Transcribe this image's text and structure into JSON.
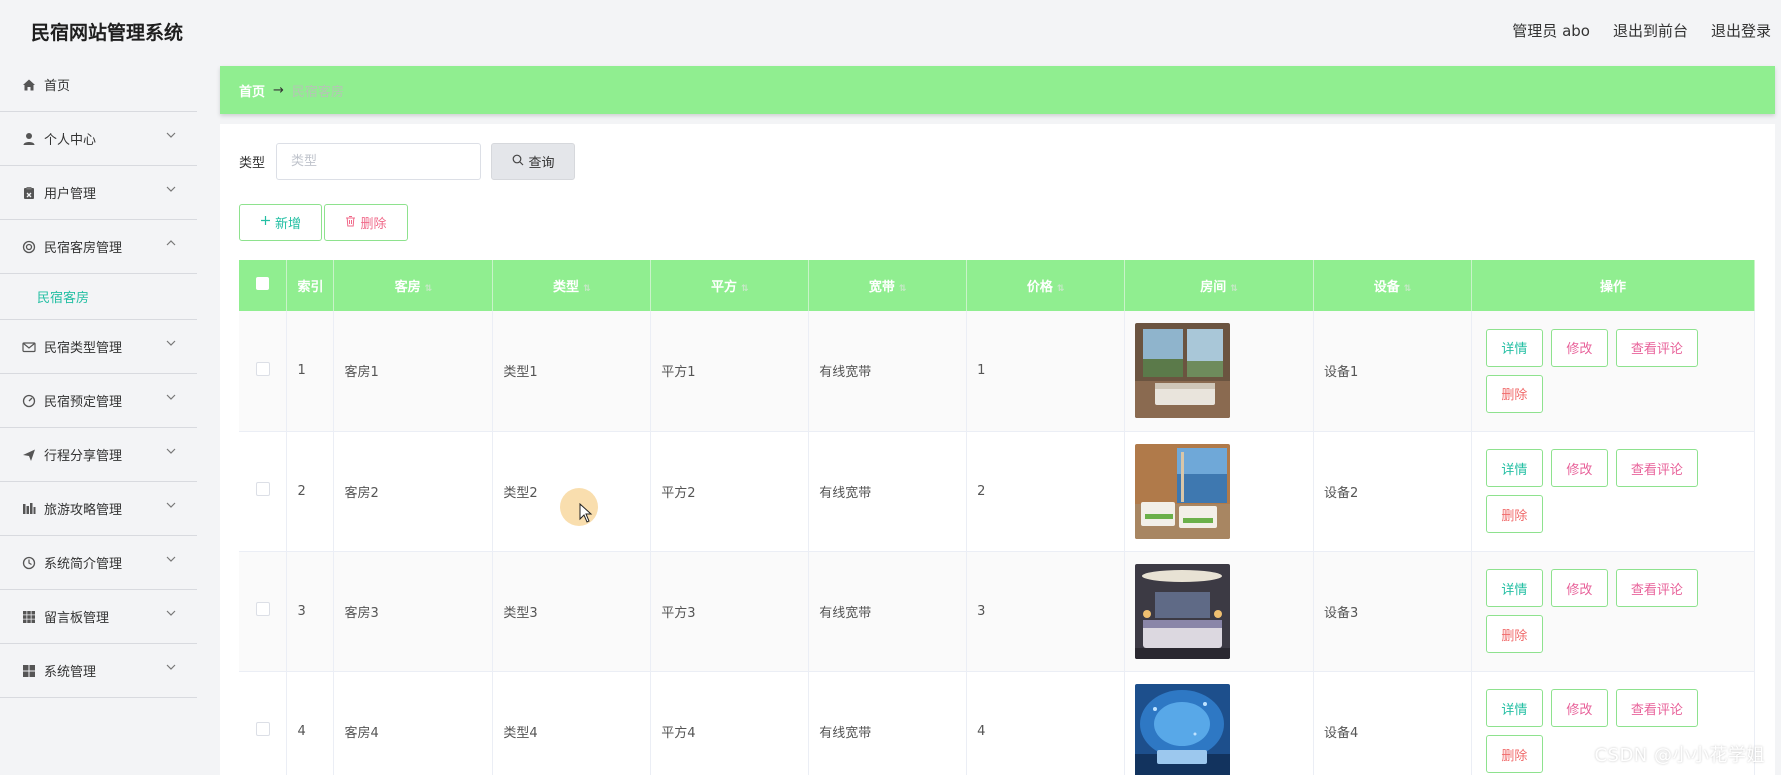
{
  "app": {
    "title": "民宿网站管理系统"
  },
  "header": {
    "admin": "管理员 abo",
    "front": "退出到前台",
    "logout": "退出登录"
  },
  "sidebar": {
    "home": "首页",
    "items": [
      {
        "label": "个人中心",
        "icon": "user-icon"
      },
      {
        "label": "用户管理",
        "icon": "clipboard-icon"
      },
      {
        "label": "民宿客房管理",
        "icon": "ring-icon",
        "expanded": true
      },
      {
        "label": "民宿类型管理",
        "icon": "mail-icon"
      },
      {
        "label": "民宿预定管理",
        "icon": "gauge-icon"
      },
      {
        "label": "行程分享管理",
        "icon": "send-icon"
      },
      {
        "label": "旅游攻略管理",
        "icon": "bars-icon"
      },
      {
        "label": "系统简介管理",
        "icon": "clock-icon"
      },
      {
        "label": "留言板管理",
        "icon": "grid-icon"
      },
      {
        "label": "系统管理",
        "icon": "apps-icon"
      }
    ],
    "sub_active": "民宿客房"
  },
  "breadcrumb": {
    "home": "首页",
    "arrow": "→",
    "current": "民宿客房"
  },
  "search": {
    "label": "类型",
    "placeholder": "类型",
    "query": "查询"
  },
  "actions": {
    "add": "新增",
    "delete": "删除"
  },
  "table": {
    "headers": [
      "索引",
      "客房",
      "类型",
      "平方",
      "宽带",
      "价格",
      "房间",
      "设备",
      "操作"
    ],
    "rows": [
      {
        "index": "1",
        "room": "客房1",
        "type": "类型1",
        "area": "平方1",
        "broadband": "有线宽带",
        "price": "1",
        "device": "设备1"
      },
      {
        "index": "2",
        "room": "客房2",
        "type": "类型2",
        "area": "平方2",
        "broadband": "有线宽带",
        "price": "2",
        "device": "设备2"
      },
      {
        "index": "3",
        "room": "客房3",
        "type": "类型3",
        "area": "平方3",
        "broadband": "有线宽带",
        "price": "3",
        "device": "设备3"
      },
      {
        "index": "4",
        "room": "客房4",
        "type": "类型4",
        "area": "平方4",
        "broadband": "有线宽带",
        "price": "4",
        "device": "设备4"
      }
    ],
    "ops": {
      "detail": "详情",
      "edit": "修改",
      "review": "查看评论",
      "remove": "删除"
    }
  },
  "watermark": "CSDN @小小花学姐",
  "colors": {
    "accent_green": "#90ee90",
    "teal": "#23bfa3",
    "pink": "#e8629a"
  }
}
